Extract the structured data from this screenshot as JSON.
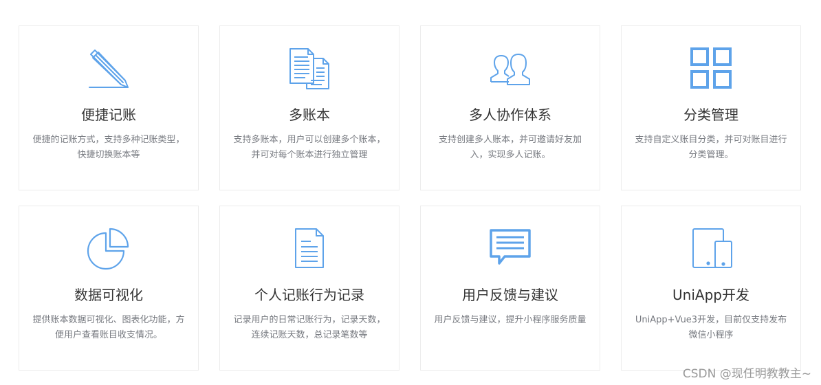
{
  "theme": {
    "icon_color": "#5ea3ea"
  },
  "features": [
    {
      "title": "便捷记账",
      "desc_line1": "便捷的记账方式，支持多种记账类型，",
      "desc_line2": "快捷切换账本等",
      "icon": "pencil-icon"
    },
    {
      "title": "多账本",
      "desc_line1": "支持多账本，用户可以创建多个账本，",
      "desc_line2": "并可对每个账本进行独立管理",
      "icon": "documents-icon"
    },
    {
      "title": "多人协作体系",
      "desc_line1": "支持创建多人账本，并可邀请好友加",
      "desc_line2": "入，实现多人记账。",
      "icon": "users-icon"
    },
    {
      "title": "分类管理",
      "desc_line1": "支持自定义账目分类，并可对账目进行",
      "desc_line2": "分类管理。",
      "icon": "grid-icon"
    },
    {
      "title": "数据可视化",
      "desc_line1": "提供账本数据可视化、图表化功能，方",
      "desc_line2": "便用户查看账目收支情况。",
      "icon": "pie-chart-icon"
    },
    {
      "title": "个人记账行为记录",
      "desc_line1": "记录用户的日常记账行为，记录天数，",
      "desc_line2": "连续记账天数，总记录笔数等",
      "icon": "document-icon"
    },
    {
      "title": "用户反馈与建议",
      "desc_line1": "用户反馈与建议，提升小程序服务质量",
      "desc_line2": "",
      "icon": "chat-bubble-icon"
    },
    {
      "title": "UniApp开发",
      "desc_line1": "UniApp+Vue3开发，目前仅支持发布",
      "desc_line2": "微信小程序",
      "icon": "devices-icon"
    }
  ],
  "watermark": "CSDN @现任明教教主~"
}
